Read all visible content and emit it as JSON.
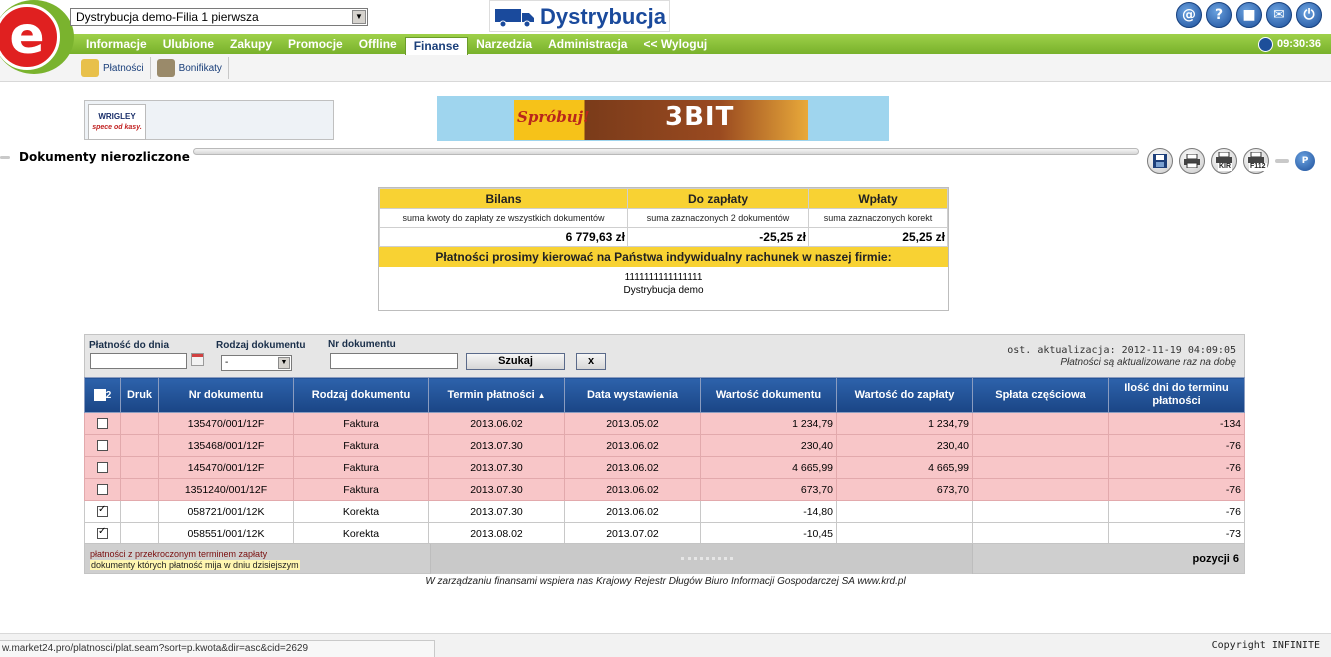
{
  "header": {
    "logo_letter": "e",
    "branch_select": "Dystrybucja demo-Filia 1 pierwsza",
    "brand_name": "Dystrybucja",
    "clock": "09:30:36",
    "top_icons": [
      {
        "name": "contact-icon",
        "glyph": "@"
      },
      {
        "name": "help-icon",
        "glyph": "?"
      },
      {
        "name": "notes-icon",
        "glyph": "■"
      },
      {
        "name": "mail-icon",
        "glyph": "✉"
      },
      {
        "name": "power-icon",
        "glyph": "⏻"
      }
    ]
  },
  "nav": {
    "items": [
      "Informacje",
      "Ulubione",
      "Zakupy",
      "Promocje",
      "Offline",
      "Finanse",
      "Narzedzia",
      "Administracja",
      "<< Wyloguj"
    ],
    "active": "Finanse"
  },
  "subnav": {
    "items": [
      {
        "label": "Płatności",
        "color": "#e8c04a"
      },
      {
        "label": "Bonifikaty",
        "color": "#9a8a6a"
      }
    ]
  },
  "banners": {
    "left_brand": "WRIGLEY",
    "left_tagline": "spece od kasy.",
    "right_slogan": "Spróbuj!",
    "right_product": "3BIT"
  },
  "page": {
    "title": "Dokumenty nierozliczone",
    "icons": [
      "save-icon",
      "print-icon",
      "print-kir-icon",
      "print-f112-icon"
    ],
    "icon_badges": {
      "kir": "KIR",
      "f112": "F112",
      "p": "P"
    }
  },
  "summary": {
    "headers": [
      "Bilans",
      "Do zapłaty",
      "Wpłaty"
    ],
    "descriptions": [
      "suma kwoty do zapłaty ze wszystkich dokumentów",
      "suma zaznaczonych 2 dokumentów",
      "suma zaznaczonych korekt"
    ],
    "values": [
      "6 779,63 zł",
      "-25,25 zł",
      "25,25 zł"
    ],
    "message": "Płatności prosimy kierować na Państwa indywidualny rachunek w naszej firmie:",
    "account": "1111111111111111",
    "company": "Dystrybucja demo"
  },
  "filters": {
    "payment_until_label": "Płatność do dnia",
    "payment_until_value": "",
    "doc_type_label": "Rodzaj dokumentu",
    "doc_type_value": "-",
    "doc_number_label": "Nr dokumentu",
    "doc_number_value": "",
    "search_label": "Szukaj",
    "clear_label": "x",
    "updated": "ost. aktualizacja: 2012-11-19 04:09:05",
    "updated_note": "Płatności są aktualizowane raz na dobę"
  },
  "table": {
    "header_count": "2",
    "columns": [
      "Druk",
      "Nr dokumentu",
      "Rodzaj dokumentu",
      "Termin płatności",
      "Data wystawienia",
      "Wartość dokumentu",
      "Wartość do zapłaty",
      "Spłata częściowa",
      "Ilość dni do terminu płatności"
    ],
    "sort_indicator": "▲",
    "rows": [
      {
        "checked": false,
        "overdue": true,
        "druk": "",
        "nr": "135470/001/12F",
        "rodzaj": "Faktura",
        "termin": "2013.06.02",
        "data": "2013.05.02",
        "wartosc": "1 234,79",
        "do_zaplaty": "1 234,79",
        "splata": "",
        "dni": "-134"
      },
      {
        "checked": false,
        "overdue": true,
        "druk": "",
        "nr": "135468/001/12F",
        "rodzaj": "Faktura",
        "termin": "2013.07.30",
        "data": "2013.06.02",
        "wartosc": "230,40",
        "do_zaplaty": "230,40",
        "splata": "",
        "dni": "-76"
      },
      {
        "checked": false,
        "overdue": true,
        "druk": "",
        "nr": "145470/001/12F",
        "rodzaj": "Faktura",
        "termin": "2013.07.30",
        "data": "2013.06.02",
        "wartosc": "4 665,99",
        "do_zaplaty": "4 665,99",
        "splata": "",
        "dni": "-76"
      },
      {
        "checked": false,
        "overdue": true,
        "druk": "",
        "nr": "1351240/001/12F",
        "rodzaj": "Faktura",
        "termin": "2013.07.30",
        "data": "2013.06.02",
        "wartosc": "673,70",
        "do_zaplaty": "673,70",
        "splata": "",
        "dni": "-76"
      },
      {
        "checked": true,
        "overdue": false,
        "druk": "",
        "nr": "058721/001/12K",
        "rodzaj": "Korekta",
        "termin": "2013.07.30",
        "data": "2013.06.02",
        "wartosc": "-14,80",
        "do_zaplaty": "",
        "splata": "",
        "dni": "-76"
      },
      {
        "checked": true,
        "overdue": false,
        "druk": "",
        "nr": "058551/001/12K",
        "rodzaj": "Korekta",
        "termin": "2013.08.02",
        "data": "2013.07.02",
        "wartosc": "-10,45",
        "do_zaplaty": "",
        "splata": "",
        "dni": "-73"
      }
    ]
  },
  "footer": {
    "legend_overdue": "płatności z przekroczonym terminem zapłaty",
    "legend_today": "dokumenty których płatność mija w dniu dzisiejszym",
    "positions": "pozycji 6",
    "krd": "W zarządzaniu finansami wspiera nas Krajowy Rejestr Długów Biuro Informacji Gospodarczej SA www.krd.pl"
  },
  "statusbar": {
    "url": "w.market24.pro/platnosci/plat.seam?sort=p.kwota&dir=asc&cid=2629",
    "copyright": "Copyright INFINITE"
  }
}
